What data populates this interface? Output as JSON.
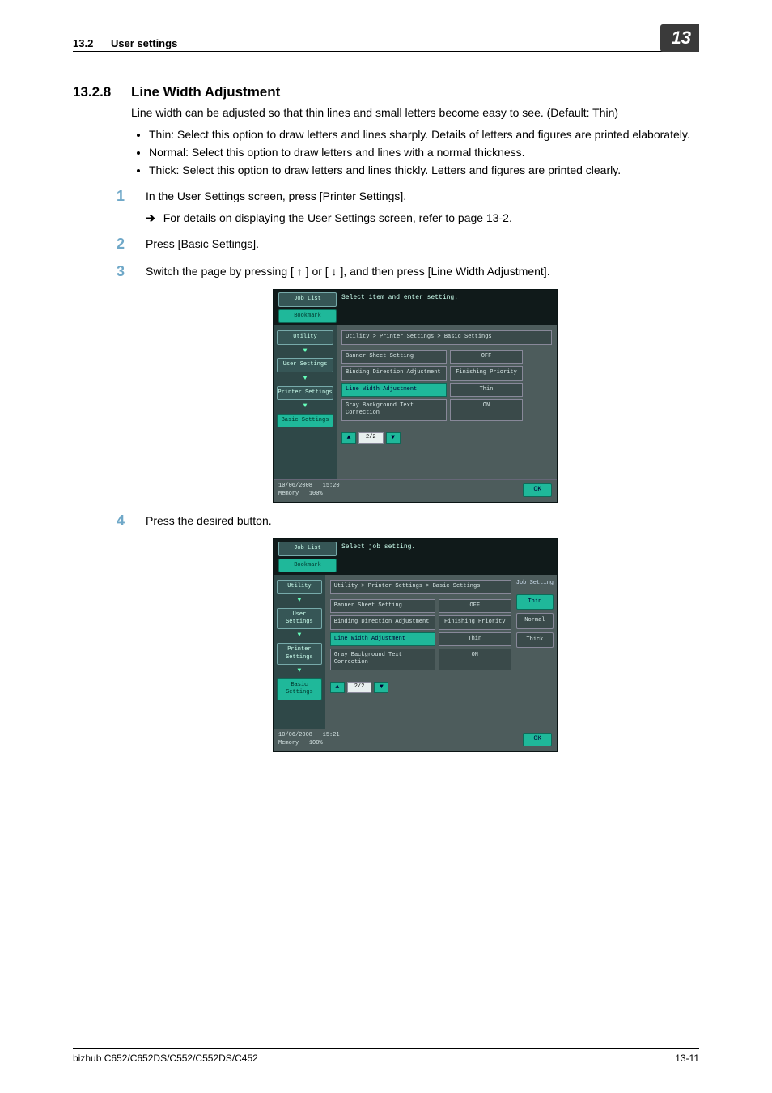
{
  "header": {
    "section_num": "13.2",
    "section_title": "User settings",
    "chapter": "13"
  },
  "section": {
    "num": "13.2.8",
    "title": "Line Width Adjustment",
    "intro": "Line width can be adjusted so that thin lines and small letters become easy to see. (Default: Thin)",
    "options": {
      "thin": "Thin: Select this option to draw letters and lines sharply. Details of letters and figures are printed elaborately.",
      "normal": "Normal: Select this option to draw letters and lines with a normal thickness.",
      "thick": "Thick: Select this option to draw letters and lines thickly. Letters and figures are printed clearly."
    }
  },
  "steps": {
    "s1": "In the User Settings screen, press [Printer Settings].",
    "s1_sub": "For details on displaying the User Settings screen, refer to page 13-2.",
    "s2": "Press [Basic Settings].",
    "s3": "Switch the page by pressing [ ↑ ] or [ ↓ ], and then press [Line Width Adjustment].",
    "s4": "Press the desired button."
  },
  "nums": {
    "n1": "1",
    "n2": "2",
    "n3": "3",
    "n4": "4"
  },
  "screen1": {
    "instruction": "Select item and enter setting.",
    "left": {
      "joblist": "Job List",
      "bookmark": "Bookmark",
      "utility": "Utility",
      "user": "User Settings",
      "printer": "Printer Settings",
      "basic": "Basic Settings"
    },
    "breadcrumb": "Utility > Printer Settings > Basic Settings",
    "rows": {
      "r1l": "Banner Sheet Setting",
      "r1v": "OFF",
      "r2l": "Binding Direction Adjustment",
      "r2v": "Finishing Priority",
      "r3l": "Line Width Adjustment",
      "r3v": "Thin",
      "r4l": "Gray Background Text Correction",
      "r4v": "ON"
    },
    "pager": "2/2",
    "footer_date": "10/06/2008",
    "footer_time": "15:20",
    "footer_mem": "Memory",
    "footer_pct": "100%",
    "ok": "OK"
  },
  "screen2": {
    "instruction": "Select job setting.",
    "left": {
      "joblist": "Job List",
      "bookmark": "Bookmark",
      "utility": "Utility",
      "user": "User Settings",
      "printer": "Printer Settings",
      "basic": "Basic Settings"
    },
    "breadcrumb": "Utility > Printer Settings > Basic Settings",
    "rows": {
      "r1l": "Banner Sheet Setting",
      "r1v": "OFF",
      "r2l": "Binding Direction Adjustment",
      "r2v": "Finishing Priority",
      "r3l": "Line Width Adjustment",
      "r3v": "Thin",
      "r4l": "Gray Background Text Correction",
      "r4v": "ON"
    },
    "pager": "2/2",
    "right_title": "Job Setting",
    "choices": {
      "thin": "Thin",
      "normal": "Normal",
      "thick": "Thick"
    },
    "footer_date": "10/06/2008",
    "footer_time": "15:21",
    "footer_mem": "Memory",
    "footer_pct": "100%",
    "ok": "OK"
  },
  "footer": {
    "model": "bizhub C652/C652DS/C552/C552DS/C452",
    "page": "13-11"
  }
}
